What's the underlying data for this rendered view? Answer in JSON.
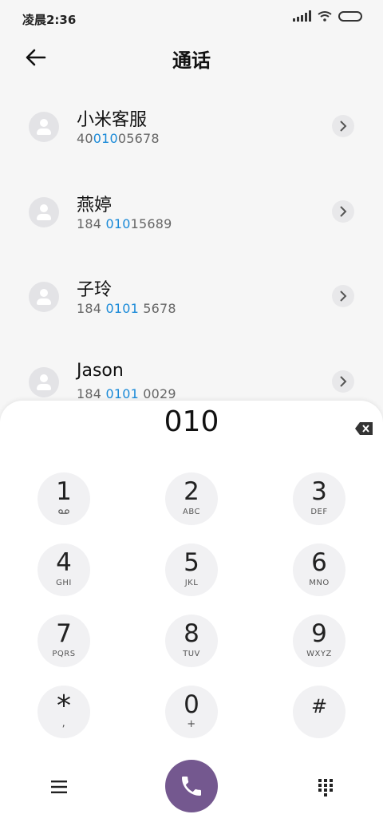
{
  "status_bar": {
    "time": "凌晨2:36"
  },
  "header": {
    "title": "通话"
  },
  "contacts": [
    {
      "name": "小米客服",
      "number_parts": [
        "40",
        "010",
        "05678"
      ]
    },
    {
      "name": "燕婷",
      "number_parts": [
        "184 ",
        "010",
        "15689"
      ]
    },
    {
      "name": "子玲",
      "number_parts": [
        "184 ",
        "0101",
        " 5678"
      ]
    },
    {
      "name": "Jason",
      "number_parts": [
        "184 ",
        "0101",
        " 0029"
      ]
    }
  ],
  "dialer": {
    "input": "010",
    "keys": [
      {
        "digit": "1",
        "letters": ""
      },
      {
        "digit": "2",
        "letters": "ABC"
      },
      {
        "digit": "3",
        "letters": "DEF"
      },
      {
        "digit": "4",
        "letters": "GHI"
      },
      {
        "digit": "5",
        "letters": "JKL"
      },
      {
        "digit": "6",
        "letters": "MNO"
      },
      {
        "digit": "7",
        "letters": "PQRS"
      },
      {
        "digit": "8",
        "letters": "TUV"
      },
      {
        "digit": "9",
        "letters": "WXYZ"
      },
      {
        "digit": "*",
        "letters": ","
      },
      {
        "digit": "0",
        "letters": "+"
      },
      {
        "digit": "#",
        "letters": ""
      }
    ]
  },
  "colors": {
    "highlight": "#1a8ad8",
    "call_button": "#74588f"
  },
  "icons": {
    "back": "arrow-left-icon",
    "chevron": "chevron-right-icon",
    "voicemail": "voicemail-icon",
    "backspace": "backspace-icon",
    "menu": "menu-icon",
    "call": "phone-icon",
    "keypad": "keypad-icon"
  }
}
